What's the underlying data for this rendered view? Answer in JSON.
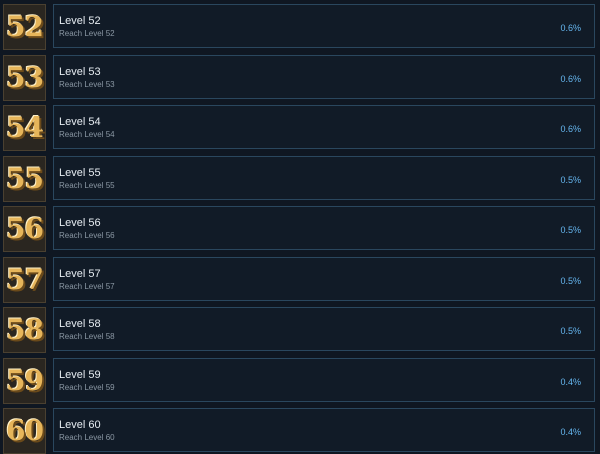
{
  "achievements": [
    {
      "badge": "52",
      "title": "Level 52",
      "description": "Reach Level 52",
      "percent": "0.6%"
    },
    {
      "badge": "53",
      "title": "Level 53",
      "description": "Reach Level 53",
      "percent": "0.6%"
    },
    {
      "badge": "54",
      "title": "Level 54",
      "description": "Reach Level 54",
      "percent": "0.6%"
    },
    {
      "badge": "55",
      "title": "Level 55",
      "description": "Reach Level 55",
      "percent": "0.5%"
    },
    {
      "badge": "56",
      "title": "Level 56",
      "description": "Reach Level 56",
      "percent": "0.5%"
    },
    {
      "badge": "57",
      "title": "Level 57",
      "description": "Reach Level 57",
      "percent": "0.5%"
    },
    {
      "badge": "58",
      "title": "Level 58",
      "description": "Reach Level 58",
      "percent": "0.5%"
    },
    {
      "badge": "59",
      "title": "Level 59",
      "description": "Reach Level 59",
      "percent": "0.4%"
    },
    {
      "badge": "60",
      "title": "Level 60",
      "description": "Reach Level 60",
      "percent": "0.4%"
    }
  ],
  "colors": {
    "background": "#0f1722",
    "card_background": "#111b27",
    "card_border": "#2a475e",
    "badge_gold": "#e6b55a",
    "percent_blue": "#66b7f0"
  }
}
